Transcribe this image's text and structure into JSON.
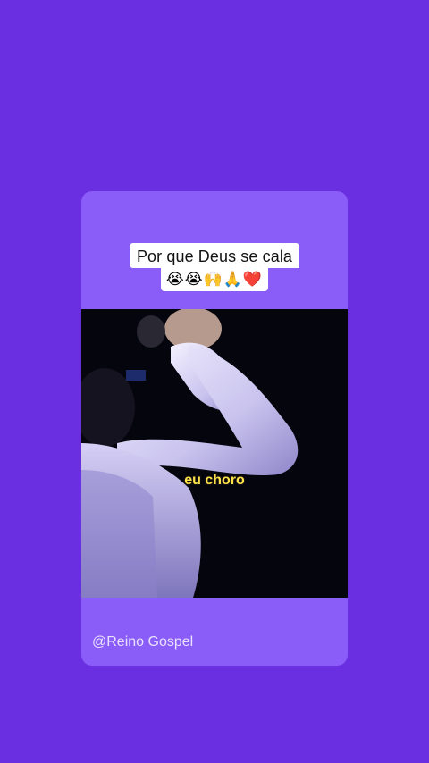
{
  "story": {
    "caption_text": "Por que Deus se cala",
    "caption_emojis": "😭😭🙌🙏❤️",
    "video_subtitle": "eu choro",
    "handle": "@Reino Gospel"
  },
  "colors": {
    "background": "#6a2fe0",
    "card": "#8a5cf8",
    "subtitle": "#ffe24a"
  }
}
